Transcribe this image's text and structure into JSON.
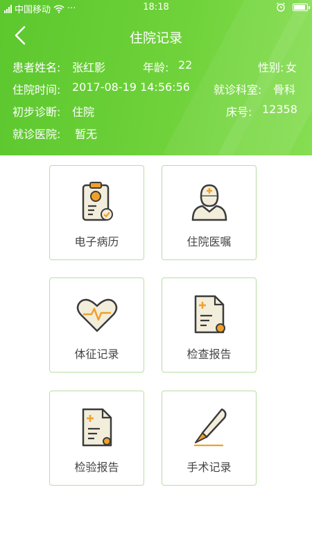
{
  "status_bar": {
    "carrier": "中国移动",
    "more": "···",
    "time": "18:18"
  },
  "nav": {
    "title": "住院记录",
    "back_icon": "chevron-left-icon"
  },
  "patient": {
    "name_label": "患者姓名:",
    "name": "张红影",
    "age_label": "年龄:",
    "age": "22",
    "gender_label": "性别:",
    "gender": "女",
    "admit_time_label": "住院时间:",
    "admit_time": "2017-08-19 14:56:56",
    "dept_label": "就诊科室:",
    "dept": "骨科",
    "diagnosis_label": "初步诊断:",
    "diagnosis": "住院",
    "bed_label": "床号:",
    "bed": "12358",
    "hospital_label": "就诊医院:",
    "hospital": "暂无"
  },
  "menu": [
    {
      "label": "电子病历",
      "icon": "medical-record-icon"
    },
    {
      "label": "住院医嘱",
      "icon": "doctor-icon"
    },
    {
      "label": "体征记录",
      "icon": "heart-pulse-icon"
    },
    {
      "label": "检查报告",
      "icon": "examination-report-icon"
    },
    {
      "label": "检验报告",
      "icon": "lab-report-icon"
    },
    {
      "label": "手术记录",
      "icon": "scalpel-icon"
    }
  ],
  "colors": {
    "header_green": "#6fd23a",
    "card_border": "#b9dda4",
    "icon_orange": "#f0a02a",
    "icon_cream": "#f3eedb",
    "icon_outline": "#3b3b3b"
  }
}
